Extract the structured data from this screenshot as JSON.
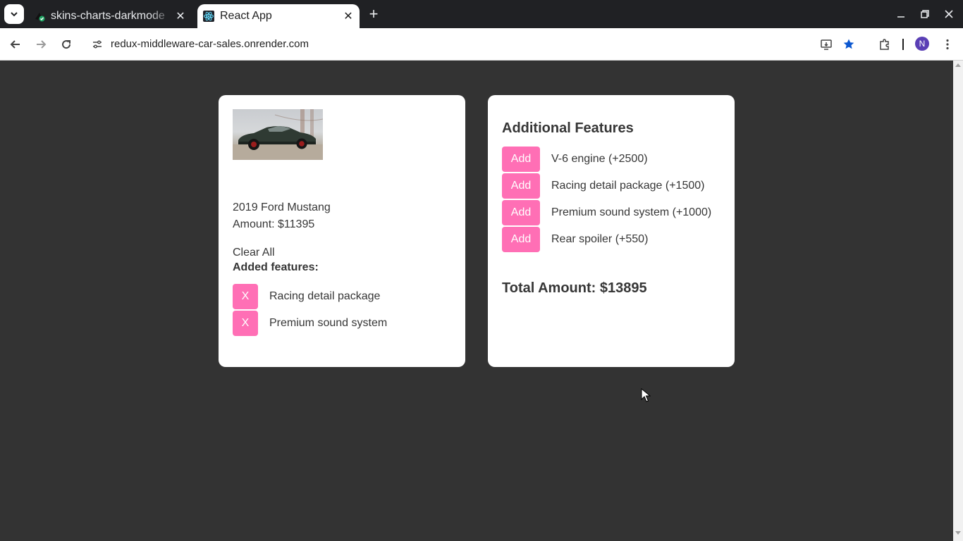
{
  "browser": {
    "tabs": [
      {
        "title": "skins-charts-darkmode",
        "active": false
      },
      {
        "title": "React App",
        "active": true
      }
    ],
    "url": "redux-middleware-car-sales.onrender.com",
    "profile_initial": "N"
  },
  "car": {
    "name": "2019 Ford Mustang",
    "amount_label": "Amount: $11395"
  },
  "added": {
    "clear_label": "Clear All",
    "title": "Added features:",
    "remove_label": "X",
    "items": [
      {
        "name": "Racing detail package"
      },
      {
        "name": "Premium sound system"
      }
    ]
  },
  "additional": {
    "title": "Additional Features",
    "add_label": "Add",
    "items": [
      {
        "label": "V-6 engine (+2500)"
      },
      {
        "label": "Racing detail package (+1500)"
      },
      {
        "label": "Premium sound system (+1000)"
      },
      {
        "label": "Rear spoiler (+550)"
      }
    ]
  },
  "total": "Total Amount: $13895",
  "colors": {
    "page_bg": "#333333",
    "card_bg": "#ffffff",
    "button_pink": "#ff6fb5",
    "text": "#363636"
  }
}
